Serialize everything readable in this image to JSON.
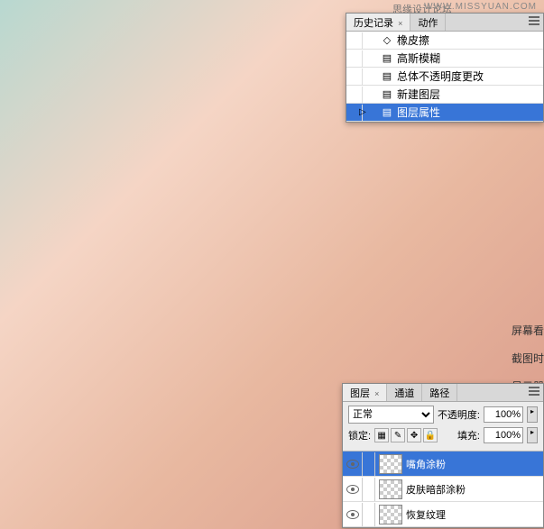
{
  "watermark": {
    "en": "WWW.MISSYUAN.COM",
    "cn": "思缘设计论坛"
  },
  "history_panel": {
    "tabs": [
      {
        "label": "历史记录",
        "active": true
      },
      {
        "label": "动作",
        "active": false
      }
    ],
    "items": [
      {
        "icon": "eraser",
        "label": "橡皮擦"
      },
      {
        "icon": "doc",
        "label": "高斯模糊"
      },
      {
        "icon": "doc",
        "label": "总体不透明度更改"
      },
      {
        "icon": "doc",
        "label": "新建图层"
      },
      {
        "icon": "doc",
        "label": "图层属性",
        "selected": true,
        "pointer": true
      }
    ]
  },
  "layers_panel": {
    "tabs": [
      {
        "label": "图层",
        "active": true
      },
      {
        "label": "通道",
        "active": false
      },
      {
        "label": "路径",
        "active": false
      }
    ],
    "blend_mode": "正常",
    "opacity_label": "不透明度:",
    "opacity_value": "100%",
    "lock_label": "锁定:",
    "fill_label": "填充:",
    "fill_value": "100%",
    "layers": [
      {
        "name": "嘴角涂粉",
        "selected": true,
        "visible": true
      },
      {
        "name": "皮肤暗部涂粉",
        "visible": true
      },
      {
        "name": "恢复纹理",
        "visible": true
      }
    ]
  },
  "right_labels": [
    "屏幕看",
    "截图时",
    "显示器"
  ]
}
